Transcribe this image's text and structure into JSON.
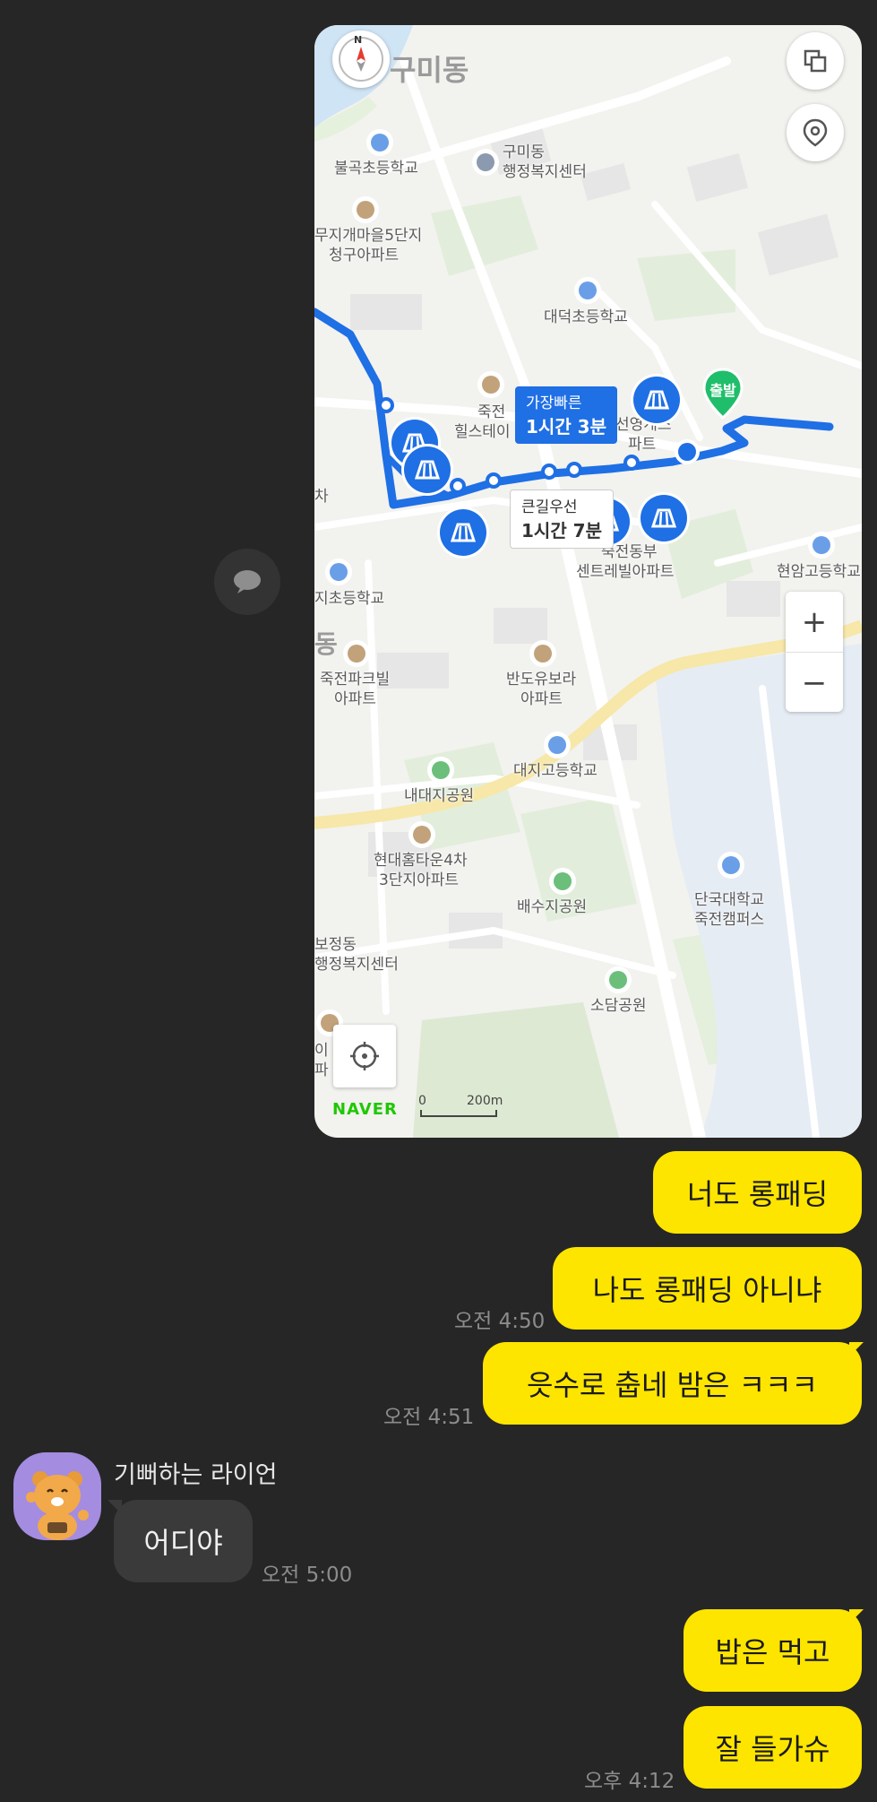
{
  "map": {
    "labels": {
      "gumi_dong": "구미동",
      "bulgok_school": "불곡초등학교",
      "gumi_center_1": "구미동",
      "gumi_center_2": "행정복지센터",
      "mujigae_1": "무지개마을5단지",
      "mujigae_2": "청구아파트",
      "daedeok_school": "대덕초등학교",
      "jukjeon_hills_1": "죽전",
      "jukjeon_hills_2": "힐스테이",
      "seonyeong_1": "선영게스",
      "seonyeong_2": "파트",
      "left_cha": "차",
      "jukjeon_central_1": "죽전동부",
      "jukjeon_central_2": "센트레빌아파트",
      "hyeonam_school": "현암고등학교",
      "ji_school": "지초등학교",
      "dong_partial": "동",
      "jukjeon_park_1": "죽전파크빌",
      "jukjeon_park_2": "아파트",
      "bando_1": "반도유보라",
      "bando_2": "아파트",
      "daeji_school": "대지고등학교",
      "naedaeji_park": "내대지공원",
      "hyundai_1": "현대홈타운4차",
      "hyundai_2": "3단지아파트",
      "baesuji_park": "배수지공원",
      "dankook_1": "단국대학교",
      "dankook_2": "죽전캠퍼스",
      "bojeong_1": "보정동",
      "bojeong_2": "행정복지센터",
      "sodam_park": "소담공원",
      "left_partial_1": "이",
      "left_partial_2": "파"
    },
    "route_fast": {
      "title": "가장빠른",
      "time": "1시간 3분"
    },
    "route_main": {
      "title": "큰길우선",
      "time": "1시간 7분"
    },
    "start_marker": "출발",
    "brand": "NAVER",
    "scale_zero": "0",
    "scale_distance": "200m",
    "zoom_in": "+",
    "zoom_out": "−",
    "compass_n": "N"
  },
  "messages": {
    "m1": "너도 롱패딩",
    "m2": "나도 롱패딩 아니냐",
    "m2_time": "오전 4:50",
    "m3": "읏수로 춥네 밤은 ㅋㅋㅋ",
    "m3_time": "오전 4:51",
    "sender_name": "기뻐하는 라이언",
    "m4": "어디야",
    "m4_time": "오전 5:00",
    "m5": "밥은 먹고",
    "m6": "잘 들가슈",
    "m6_time": "오후 4:12"
  },
  "colors": {
    "background": "#262626",
    "my_bubble": "#fee500",
    "other_bubble": "#3a3a3a",
    "route": "#1f6fe5",
    "avatar_bg": "#a48ce0"
  }
}
